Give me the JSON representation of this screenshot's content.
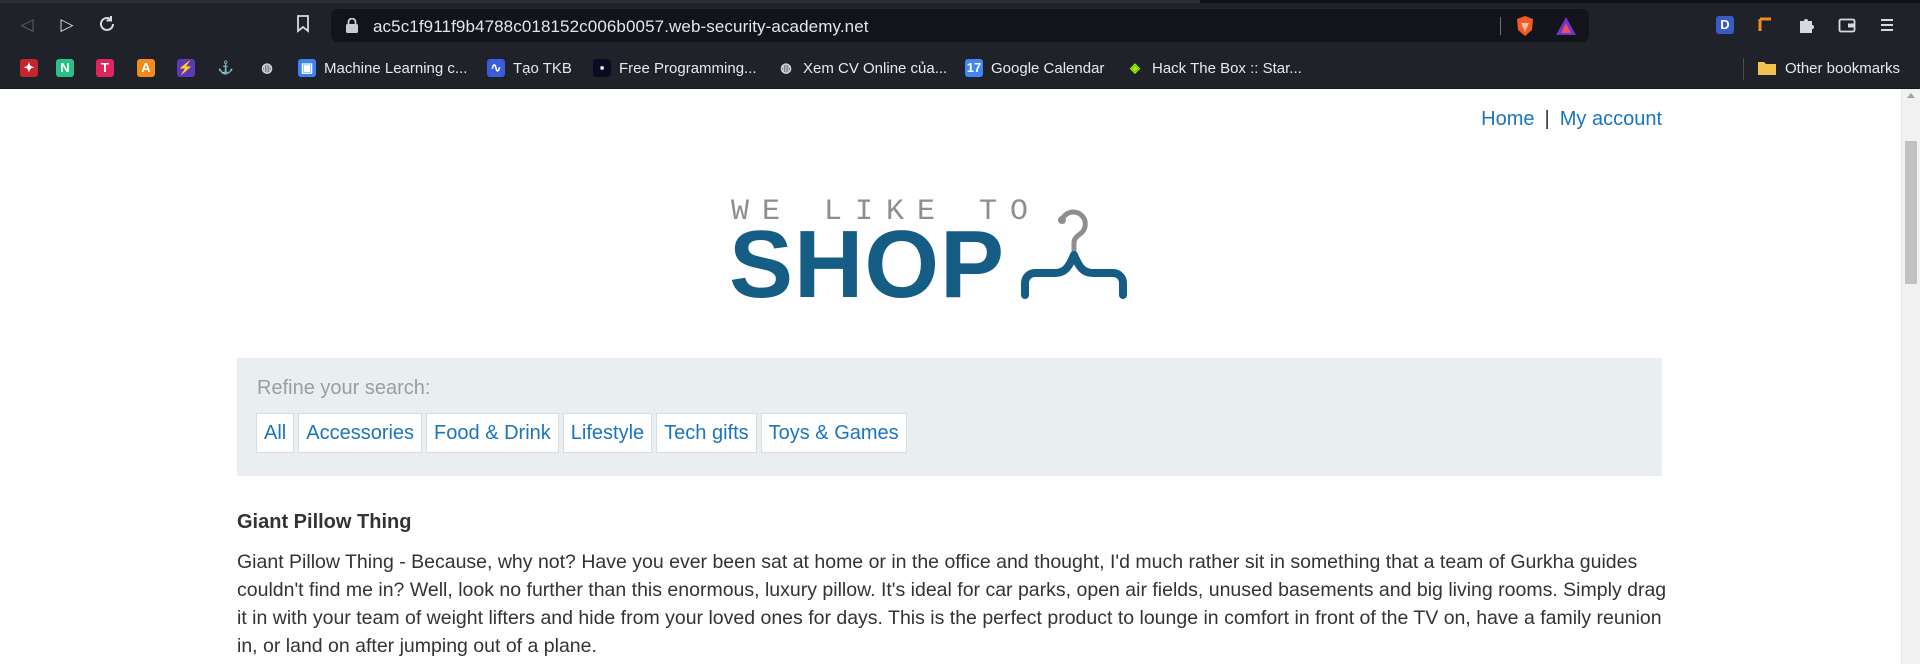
{
  "browser": {
    "url": "ac5c1f911f9b4788c018152c006b0057.web-security-academy.net",
    "bookmarks": [
      {
        "label": "",
        "icon": "eagle-icon",
        "color": "#c4262e"
      },
      {
        "label": "",
        "icon": "n-letter-icon",
        "color": "#29c087"
      },
      {
        "label": "",
        "icon": "t-letter-icon",
        "color": "#e0245e"
      },
      {
        "label": "",
        "icon": "a-letter-icon",
        "color": "#f28a1e"
      },
      {
        "label": "",
        "icon": "bolt-icon",
        "color": "#5b3bb5"
      },
      {
        "label": "",
        "icon": "ship-icon",
        "color": "#ffffff"
      },
      {
        "label": "",
        "icon": "globe-icon",
        "color": "#d8d8d8"
      },
      {
        "label": "Machine Learning c...",
        "icon": "ml-icon",
        "color": "#3b82f6"
      },
      {
        "label": "Tạo TKB",
        "icon": "swirl-icon",
        "color": "#3b5bdb"
      },
      {
        "label": "Free Programming...",
        "icon": "fcc-icon",
        "color": "#0a0a23"
      },
      {
        "label": "Xem CV Online của...",
        "icon": "globe-icon",
        "color": "#d8d8d8"
      },
      {
        "label": "Google Calendar",
        "icon": "calendar-icon",
        "color": "#4285f4"
      },
      {
        "label": "Hack The Box :: Star...",
        "icon": "cube-icon",
        "color": "#9fef00"
      }
    ],
    "other_bookmarks": "Other bookmarks"
  },
  "header": {
    "home": "Home",
    "separator": "|",
    "my_account": "My account"
  },
  "logo": {
    "tagline": "WE LIKE TO",
    "word": "SHOP"
  },
  "filter": {
    "label": "Refine your search:",
    "categories": [
      "All",
      "Accessories",
      "Food & Drink",
      "Lifestyle",
      "Tech gifts",
      "Toys & Games"
    ]
  },
  "product": {
    "title": "Giant Pillow Thing",
    "description": "Giant Pillow Thing - Because, why not? Have you ever been sat at home or in the office and thought, I'd much rather sit in something that a team of Gurkha guides couldn't find me in? Well, look no further than this enormous, luxury pillow. It's ideal for car parks, open air fields, unused basements and big living rooms. Simply drag it in with your team of weight lifters and hide from your loved ones for days. This is the perfect product to lounge in comfort in front of the TV on, have a family reunion in, or land on after jumping out of a plane."
  },
  "colors": {
    "link": "#1b75bc",
    "logo_blue": "#155d85",
    "filter_bg": "#e9eef1"
  }
}
